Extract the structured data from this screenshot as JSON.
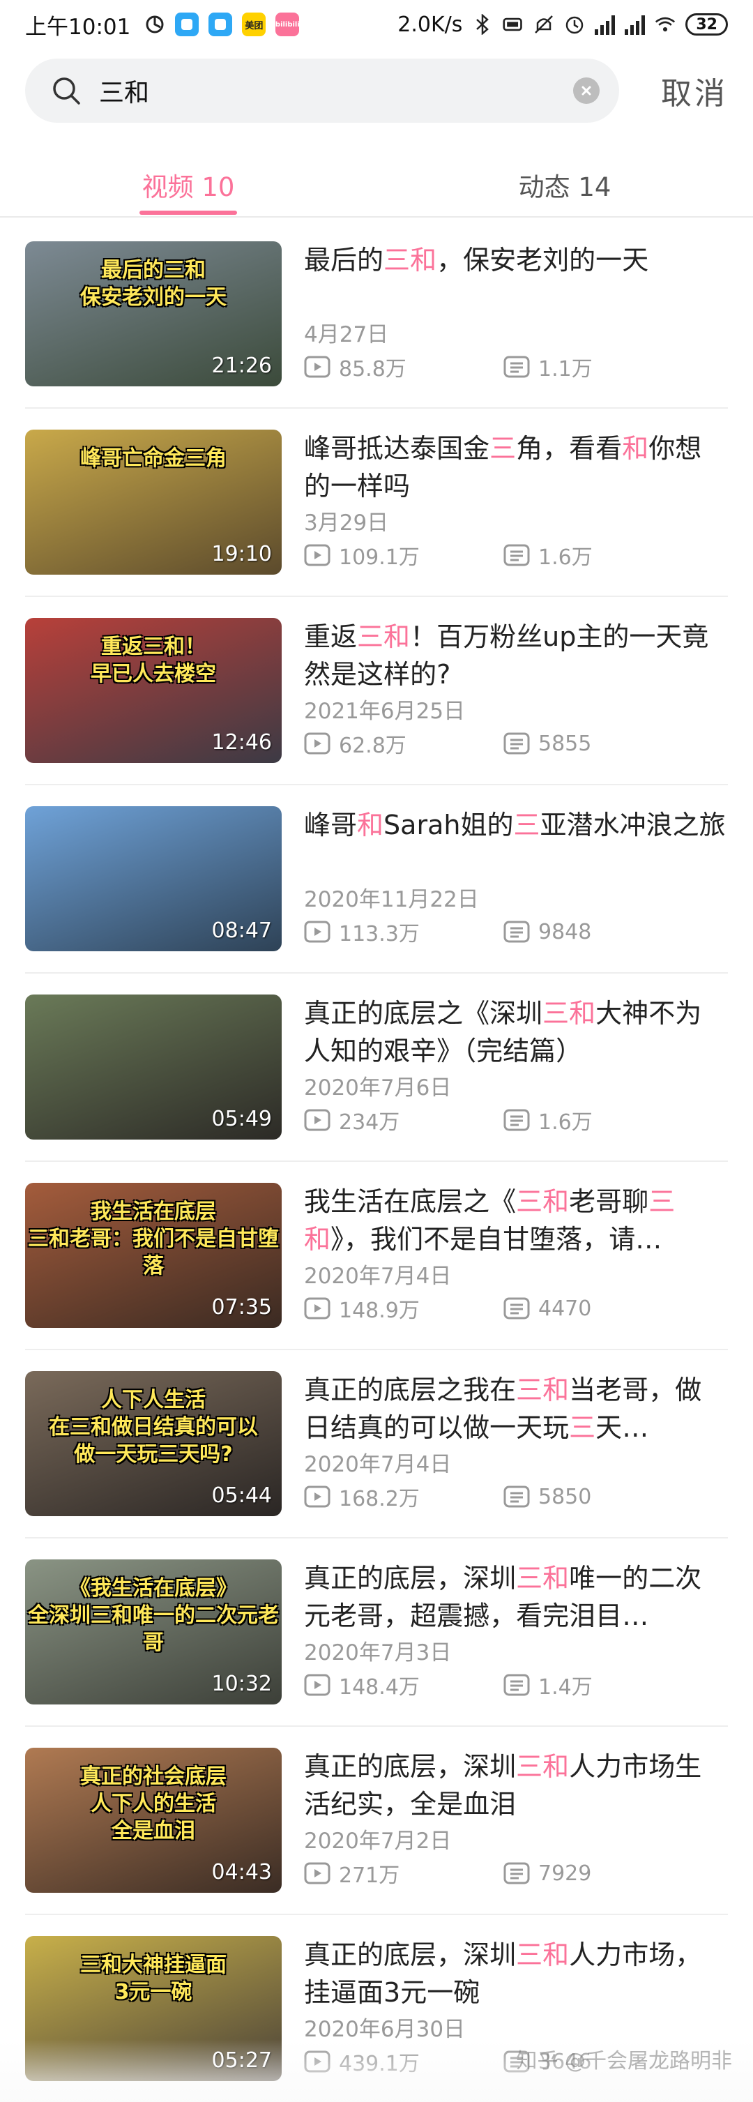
{
  "status_bar": {
    "time": "上午10:01",
    "app_badges": [
      "meituan",
      "bilibili"
    ],
    "meituan_label": "美团",
    "bili_label": "bilibili",
    "network_speed": "2.0K/s",
    "battery": "32"
  },
  "search": {
    "query": "三和",
    "cancel_label": "取消"
  },
  "tabs": [
    {
      "label": "视频 10",
      "active": true
    },
    {
      "label": "动态 14",
      "active": false
    }
  ],
  "highlight_color": "#fb7299",
  "videos": [
    {
      "thumb_text": "最后的三和\n保安老刘的一天",
      "duration": "21:26",
      "title": "最后的三和，保安老刘的一天",
      "date": "4月27日",
      "views": "85.8万",
      "comments": "1.1万",
      "thumb_colors": [
        "#7d8a94",
        "#3b4a3a"
      ]
    },
    {
      "thumb_text": "峰哥亡命金三角",
      "duration": "19:10",
      "title": "峰哥抵达泰国金三角，看看和你想的一样吗",
      "date": "3月29日",
      "views": "109.1万",
      "comments": "1.6万",
      "thumb_colors": [
        "#c9a94a",
        "#5b4a2c"
      ]
    },
    {
      "thumb_text": "重返三和！\n早已人去楼空",
      "duration": "12:46",
      "title": "重返三和！百万粉丝up主的一天竟然是这样的?",
      "date": "2021年6月25日",
      "views": "62.8万",
      "comments": "5855",
      "thumb_colors": [
        "#b8403a",
        "#3c3a44"
      ]
    },
    {
      "thumb_text": "",
      "duration": "08:47",
      "title": "峰哥和Sarah姐的三亚潜水冲浪之旅",
      "date": "2020年11月22日",
      "views": "113.3万",
      "comments": "9848",
      "thumb_colors": [
        "#6fa2d8",
        "#2e4256"
      ]
    },
    {
      "thumb_text": "",
      "duration": "05:49",
      "title": "真正的底层之《深圳三和大神不为人知的艰辛》（完结篇）",
      "date": "2020年7月6日",
      "views": "234万",
      "comments": "1.6万",
      "thumb_colors": [
        "#6a7a58",
        "#2c2a26"
      ]
    },
    {
      "thumb_text": "我生活在底层\n三和老哥：我们不是自甘堕落",
      "duration": "07:35",
      "title": "我生活在底层之《三和老哥聊三和》，我们不是自甘堕落，请…",
      "date": "2020年7月4日",
      "views": "148.9万",
      "comments": "4470",
      "thumb_colors": [
        "#a45c3c",
        "#3a2a22"
      ]
    },
    {
      "thumb_text": "人下人生活\n在三和做日结真的可以\n做一天玩三天吗?",
      "duration": "05:44",
      "title": "真正的底层之我在三和当老哥，做日结真的可以做一天玩三天…",
      "date": "2020年7月4日",
      "views": "168.2万",
      "comments": "5850",
      "thumb_colors": [
        "#7a6a5a",
        "#2a2624"
      ]
    },
    {
      "thumb_text": "《我生活在底层》\n全深圳三和唯一的二次元老哥",
      "duration": "10:32",
      "title": "真正的底层，深圳三和唯一的二次元老哥，超震撼，看完泪目…",
      "date": "2020年7月3日",
      "views": "148.4万",
      "comments": "1.4万",
      "thumb_colors": [
        "#8a9484",
        "#3c3f38"
      ]
    },
    {
      "thumb_text": "真正的社会底层\n人下人的生活\n全是血泪",
      "duration": "04:43",
      "title": "真正的底层，深圳三和人力市场生活纪实，全是血泪",
      "date": "2020年7月2日",
      "views": "271万",
      "comments": "7929",
      "thumb_colors": [
        "#b07a52",
        "#3a2c24"
      ]
    },
    {
      "thumb_text": "三和大神挂逼面\n3元一碗",
      "duration": "05:27",
      "title": "真正的底层，深圳三和人力市场，挂逼面3元一碗",
      "date": "2020年6月30日",
      "views": "439.1万",
      "comments": "3646",
      "thumb_colors": [
        "#c8b04a",
        "#4a4238"
      ]
    }
  ],
  "watermark": "知乎 @千会屠龙路明非"
}
